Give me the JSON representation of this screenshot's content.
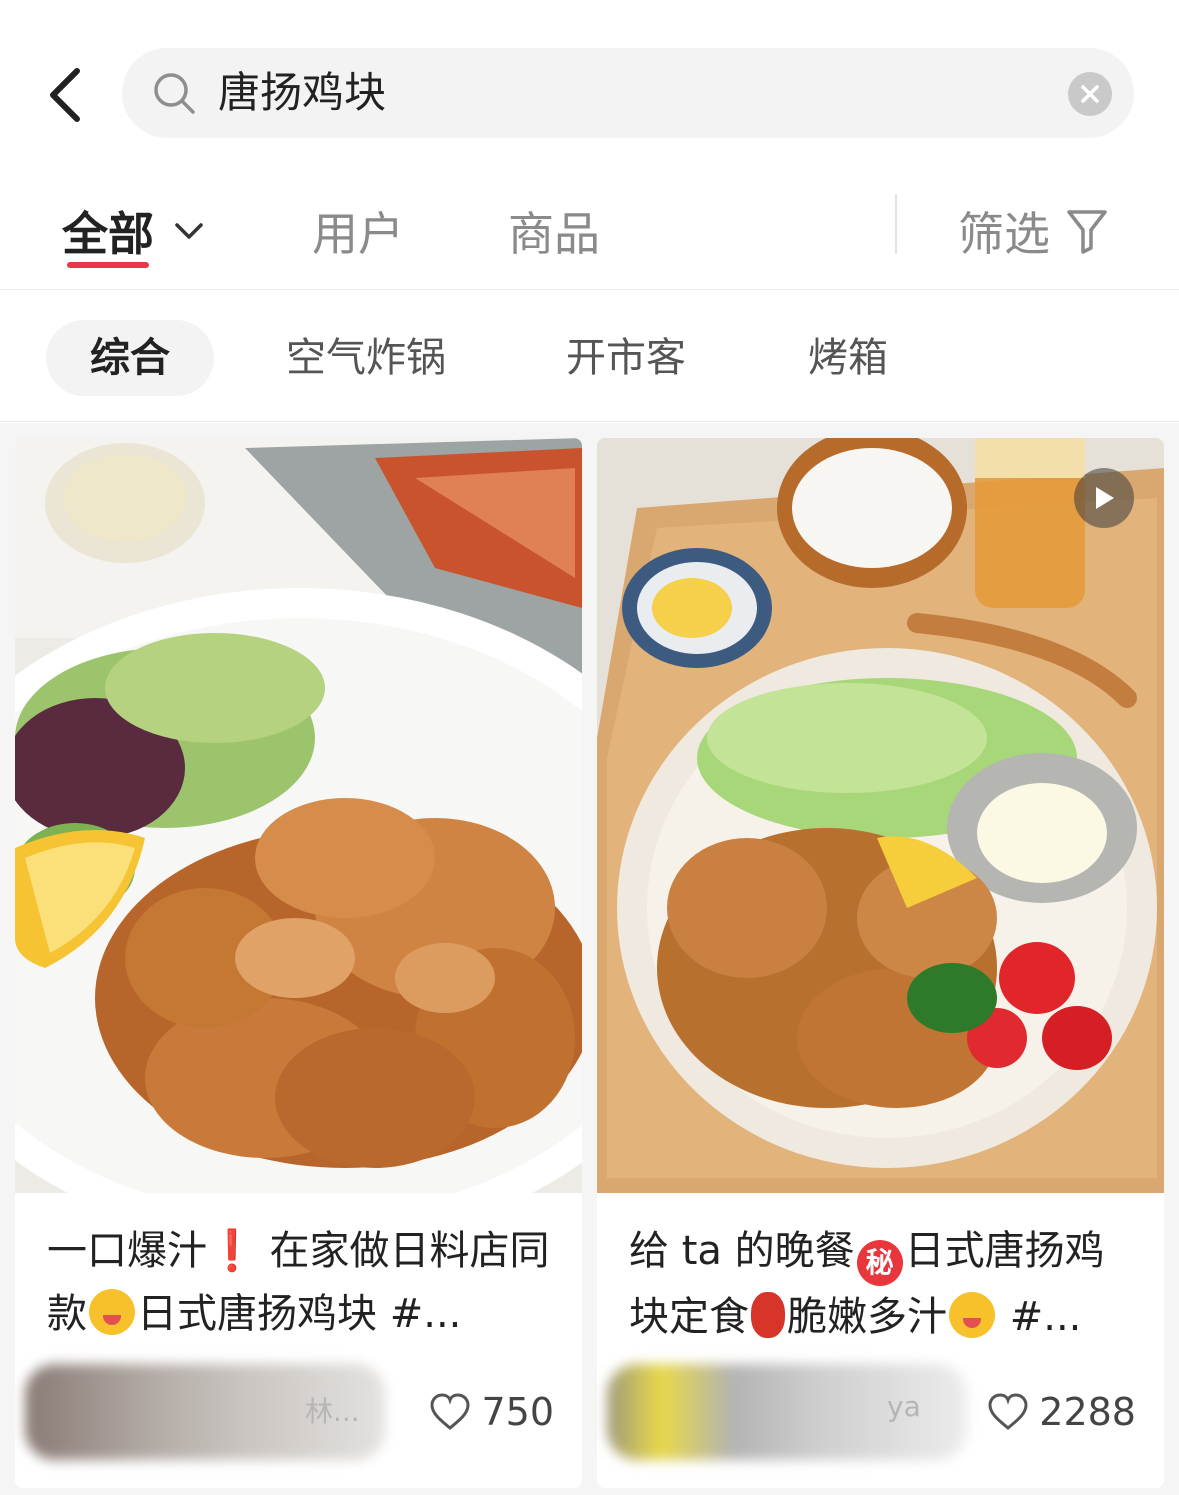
{
  "search": {
    "query": "唐扬鸡块"
  },
  "tabs": {
    "all": "全部",
    "users": "用户",
    "goods": "商品",
    "filter": "筛选"
  },
  "chips": [
    "综合",
    "空气炸锅",
    "开市客",
    "烤箱"
  ],
  "cards": [
    {
      "title_part1": "一口爆汁",
      "title_bang": "❗",
      "title_part2": " 在家做日料店同款",
      "title_part3": "日式唐扬鸡块 #...",
      "author": "林...",
      "likes": "750",
      "has_video": false
    },
    {
      "title_part1": "给 ta 的晚餐",
      "title_secret": "秘",
      "title_part2": "日式唐扬鸡块定食",
      "title_part3": "脆嫩多汁",
      "title_part4": " #...",
      "author": "ya",
      "likes": "2288",
      "has_video": true
    }
  ],
  "colors": {
    "accent": "#e8364a",
    "chip_bg": "#f3f3f3"
  },
  "icons": [
    "back-arrow-icon",
    "search-icon",
    "clear-icon",
    "chevron-down-icon",
    "filter-icon",
    "play-icon",
    "heart-icon"
  ]
}
